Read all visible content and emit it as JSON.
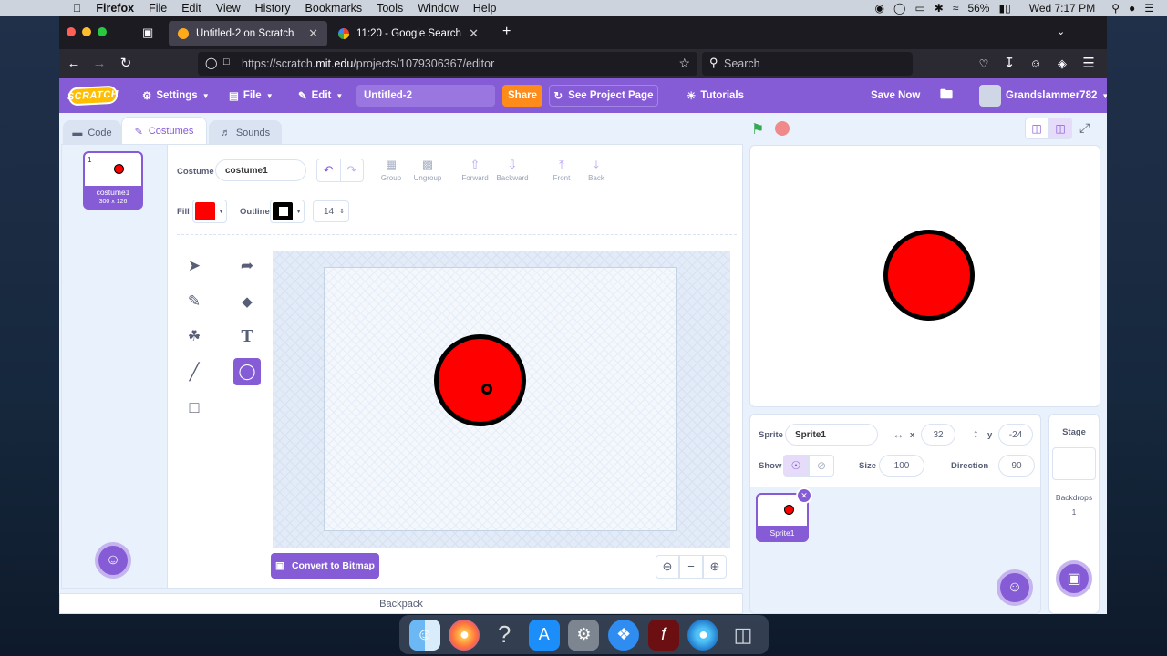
{
  "menubar": {
    "apple": "",
    "app": "Firefox",
    "items": [
      "File",
      "Edit",
      "View",
      "History",
      "Bookmarks",
      "Tools",
      "Window",
      "Help"
    ],
    "battery": "56%",
    "clock": "Wed 7:17 PM"
  },
  "browser": {
    "tabs": [
      {
        "title": "Untitled-2 on Scratch"
      },
      {
        "title": "11:20 - Google Search"
      }
    ],
    "url_prefix": "https://scratch.",
    "url_host": "mit.edu",
    "url_path": "/projects/1079306367/editor",
    "search_placeholder": "Search"
  },
  "scratch": {
    "logo": "SCRATCH",
    "menu": {
      "settings": "Settings",
      "file": "File",
      "edit": "Edit",
      "project_title": "Untitled-2",
      "share": "Share",
      "see_project": "See Project Page",
      "tutorials": "Tutorials",
      "save_now": "Save Now",
      "username": "Grandslammer782"
    },
    "tabs": {
      "code": "Code",
      "costumes": "Costumes",
      "sounds": "Sounds"
    },
    "costume": {
      "index": "1",
      "name": "costume1",
      "size": "300 x 126"
    },
    "paint": {
      "costume_label": "Costume",
      "costume_value": "costume1",
      "group": "Group",
      "ungroup": "Ungroup",
      "forward": "Forward",
      "backward": "Backward",
      "front": "Front",
      "back": "Back",
      "fill_label": "Fill",
      "outline_label": "Outline",
      "outline_width": "14",
      "fill_color": "#ff0000",
      "outline_color": "#000000",
      "convert": "Convert to Bitmap",
      "zoom_reset": "="
    },
    "backpack": "Backpack",
    "sprite": {
      "label": "Sprite",
      "name": "Sprite1",
      "x_label": "x",
      "x": "32",
      "y_label": "y",
      "y": "-24",
      "show_label": "Show",
      "size_label": "Size",
      "size": "100",
      "direction_label": "Direction",
      "direction": "90",
      "tile_name": "Sprite1"
    },
    "stage_panel": {
      "title": "Stage",
      "backdrops_label": "Backdrops",
      "backdrops_count": "1"
    },
    "accent": "#855cd6"
  }
}
